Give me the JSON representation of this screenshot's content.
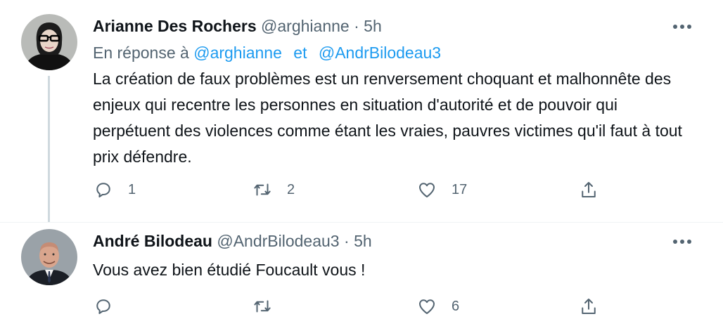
{
  "tweets": [
    {
      "author_name": "Arianne Des Rochers",
      "handle": "@arghianne",
      "separator": "·",
      "time": "5h",
      "reply_prefix": "En réponse à",
      "reply_to_1": "@arghianne",
      "reply_conj": "et",
      "reply_to_2": "@AndrBilodeau3",
      "text": "La création de faux problèmes est un renversement choquant et malhonnête des enjeux qui recentre les personnes en situation d'autorité et de pouvoir qui perpétuent des violences comme étant les vraies, pauvres victimes qu'il faut à tout prix défendre.",
      "replies": "1",
      "retweets": "2",
      "likes": "17",
      "avatar_icon": "woman-with-glasses-avatar"
    },
    {
      "author_name": "André Bilodeau",
      "handle": "@AndrBilodeau3",
      "separator": "·",
      "time": "5h",
      "text": "Vous avez bien étudié Foucault vous !",
      "replies": "",
      "retweets": "",
      "likes": "6",
      "avatar_icon": "man-in-suit-avatar"
    }
  ],
  "icons": {
    "more": "more-horizontal-icon",
    "reply": "reply-bubble-icon",
    "retweet": "retweet-icon",
    "like": "heart-icon",
    "share": "share-upload-icon"
  },
  "colors": {
    "text": "#0f1419",
    "secondary": "#536471",
    "link": "#1d9bf0",
    "thread_line": "#cfd9de"
  }
}
